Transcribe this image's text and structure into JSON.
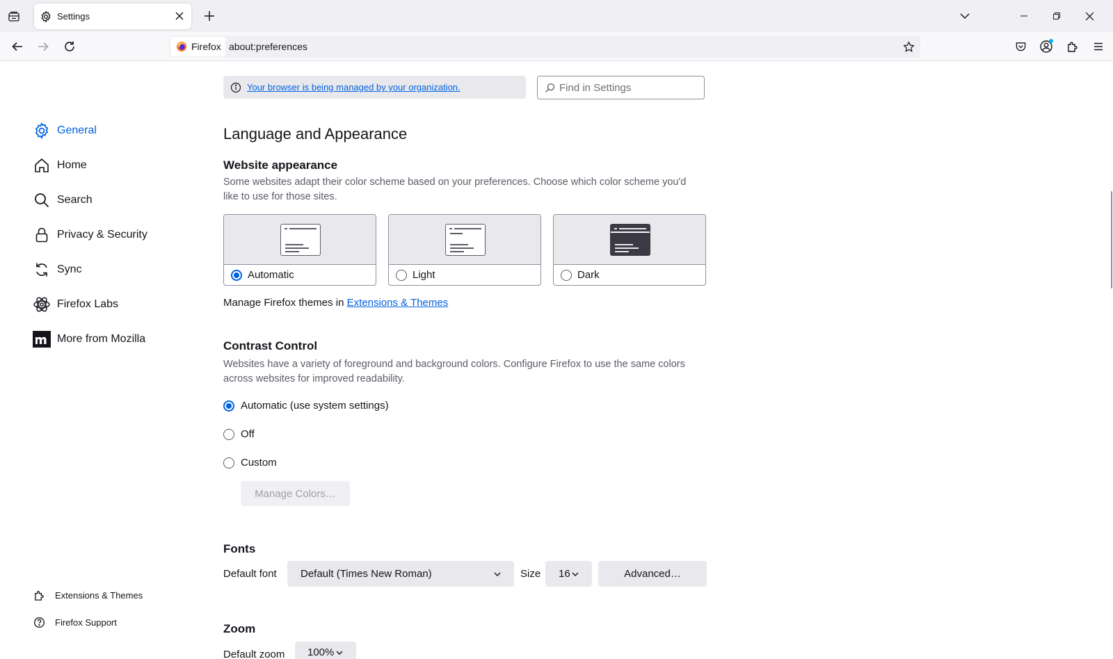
{
  "tab": {
    "title": "Settings"
  },
  "navbar": {
    "identity_label": "Firefox",
    "url": "about:preferences"
  },
  "sidebar": {
    "categories": [
      {
        "label": "General",
        "icon": "gear-icon",
        "selected": true
      },
      {
        "label": "Home",
        "icon": "home-icon"
      },
      {
        "label": "Search",
        "icon": "search-icon"
      },
      {
        "label": "Privacy & Security",
        "icon": "lock-icon"
      },
      {
        "label": "Sync",
        "icon": "sync-icon"
      },
      {
        "label": "Firefox Labs",
        "icon": "atom-icon"
      },
      {
        "label": "More from Mozilla",
        "icon": "mozilla-m-icon"
      }
    ],
    "footer": [
      {
        "label": "Extensions & Themes",
        "icon": "puzzle-icon"
      },
      {
        "label": "Firefox Support",
        "icon": "help-icon"
      }
    ]
  },
  "policy_notice": "Your browser is being managed by your organization.",
  "search": {
    "placeholder": "Find in Settings"
  },
  "language_appearance": {
    "heading": "Language and Appearance",
    "website_appearance": {
      "heading": "Website appearance",
      "description": "Some websites adapt their color scheme based on your preferences. Choose which color scheme you'd like to use for those sites.",
      "options": [
        {
          "label": "Automatic",
          "selected": true
        },
        {
          "label": "Light",
          "selected": false
        },
        {
          "label": "Dark",
          "selected": false
        }
      ]
    },
    "manage_themes_prefix": "Manage Firefox themes in ",
    "manage_themes_link": "Extensions & Themes"
  },
  "contrast_control": {
    "heading": "Contrast Control",
    "description": "Websites have a variety of foreground and background colors. Configure Firefox to use the same colors across websites for improved readability.",
    "options": [
      {
        "label": "Automatic (use system settings)",
        "selected": true
      },
      {
        "label": "Off",
        "selected": false
      },
      {
        "label": "Custom",
        "selected": false
      }
    ],
    "manage_colors_label": "Manage Colors…"
  },
  "fonts": {
    "heading": "Fonts",
    "default_font_label": "Default font",
    "default_font_value": "Default (Times New Roman)",
    "size_label": "Size",
    "size_value": "16",
    "advanced_label": "Advanced…"
  },
  "zoom": {
    "heading": "Zoom",
    "default_zoom_label": "Default zoom",
    "default_zoom_value": "100%"
  },
  "colors": {
    "accent": "#0061e0",
    "text": "#15141a",
    "muted_text": "#5b5b66",
    "button_bg": "#e9e9ed"
  }
}
